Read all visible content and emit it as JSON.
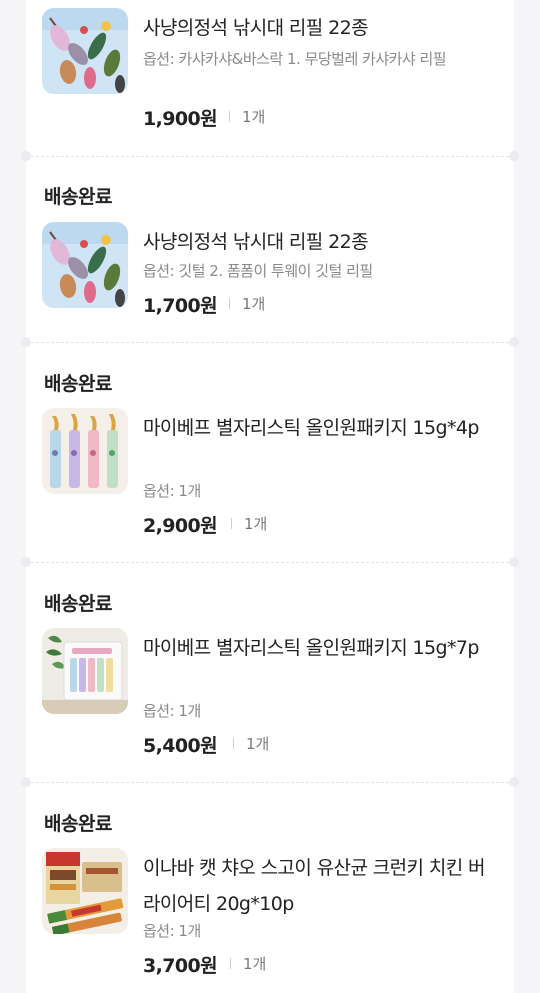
{
  "orders": [
    {
      "title": "사냥의정석 낚시대 리필 22종",
      "option": "옵션: 카샤카샤&바스락 1. 무당벌레 카샤카샤 리필",
      "price": "1,900원",
      "qty": "1개",
      "thumb_icon": "feather-toy-icon"
    },
    {
      "status": "배송완료",
      "title": "사냥의정석 낚시대 리필 22종",
      "option": "옵션: 깃털 2. 폼폼이 투웨이 깃털 리필",
      "price": "1,700원",
      "qty": "1개",
      "thumb_icon": "feather-toy-icon"
    },
    {
      "status": "배송완료",
      "title": "마이베프 별자리스틱 올인원패키지 15g*4p",
      "option": "옵션: 1개",
      "price": "2,900원",
      "qty": "1개",
      "thumb_icon": "treat-stick-icon"
    },
    {
      "status": "배송완료",
      "title": "마이베프 별자리스틱 올인원패키지 15g*7p",
      "option": "옵션: 1개",
      "price": "5,400원",
      "qty": "1개",
      "thumb_icon": "treat-package-icon"
    },
    {
      "status": "배송완료",
      "title": "이나바 캣 챠오 스고이 유산균 크런키 치킨 버라이어티 20g*10p",
      "option": "옵션: 1개",
      "price": "3,700원",
      "qty": "1개",
      "thumb_icon": "snack-box-icon"
    }
  ],
  "colors": {
    "page_bg": "#f5f5f7",
    "card_bg": "#ffffff",
    "text_primary": "#222222",
    "text_secondary": "#8a8a8e"
  }
}
